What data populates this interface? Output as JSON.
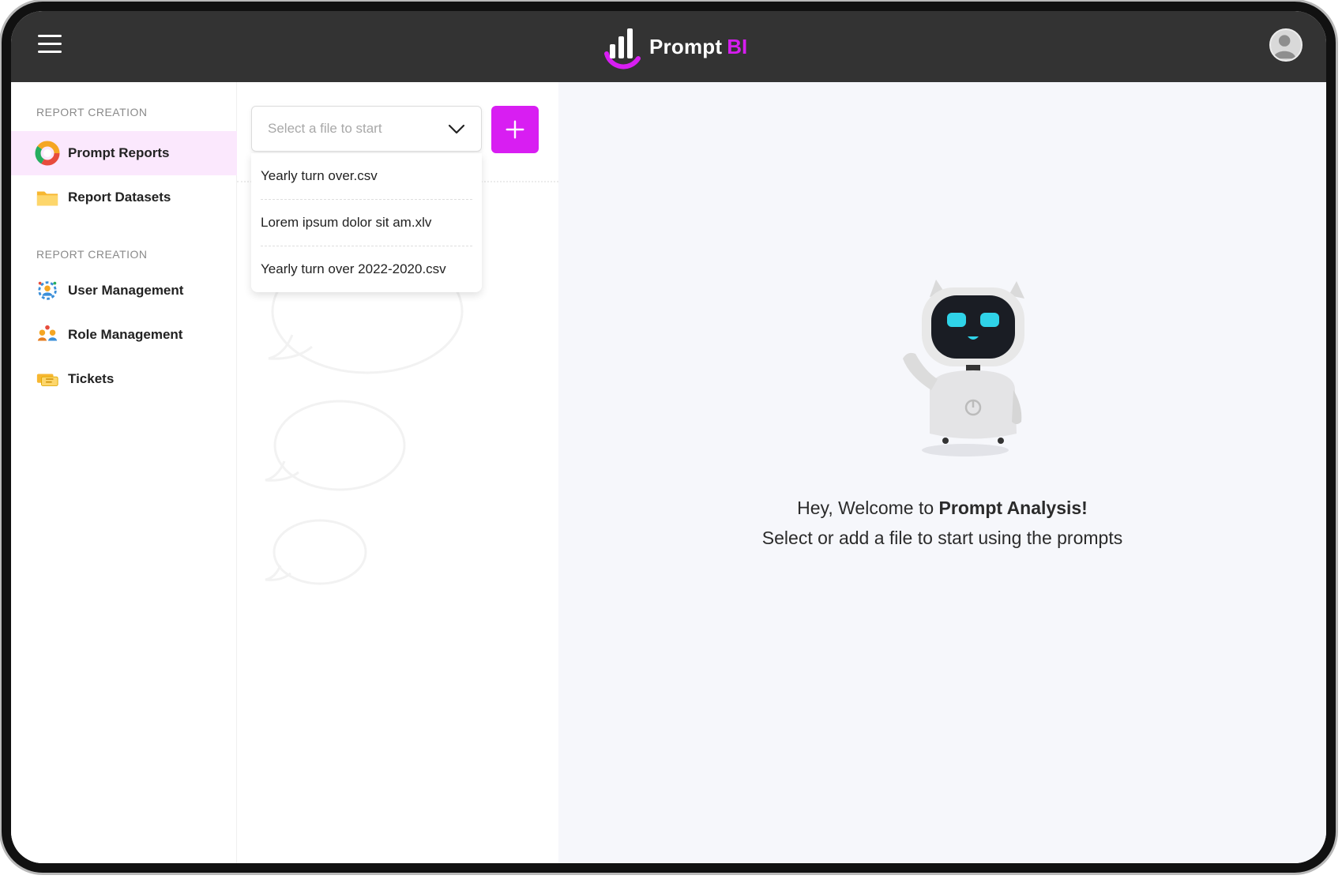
{
  "app": {
    "brand_name": "Prompt",
    "brand_accent": "BI",
    "accent_color": "#d81ef2",
    "topbar_color": "#333333"
  },
  "header": {
    "menu_icon": "hamburger-icon",
    "avatar_icon": "user-avatar-icon"
  },
  "sidebar": {
    "sections": [
      {
        "label": "REPORT CREATION",
        "items": [
          {
            "label": "Prompt Reports",
            "icon": "donut-chart-icon",
            "active": true
          },
          {
            "label": "Report Datasets",
            "icon": "folder-icon",
            "active": false
          }
        ]
      },
      {
        "label": "REPORT CREATION",
        "items": [
          {
            "label": "User Management",
            "icon": "users-gear-icon",
            "active": false
          },
          {
            "label": "Role Management",
            "icon": "role-users-icon",
            "active": false
          },
          {
            "label": "Tickets",
            "icon": "ticket-icon",
            "active": false
          }
        ]
      }
    ]
  },
  "file_select": {
    "placeholder": "Select a file to start",
    "options": [
      "Yearly turn over.csv",
      "Lorem ipsum dolor sit am.xlv",
      "Yearly turn over 2022-2020.csv"
    ]
  },
  "welcome": {
    "line1_prefix": "Hey, Welcome to ",
    "line1_bold": "Prompt Analysis!",
    "line2": "Select or add a file to start using the prompts"
  }
}
